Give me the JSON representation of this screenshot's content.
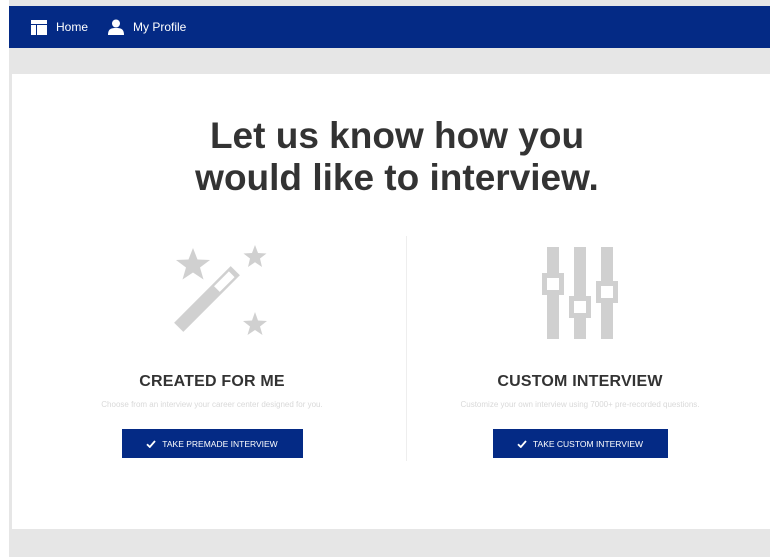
{
  "nav": {
    "home_label": "Home",
    "profile_label": "My Profile",
    "icons": {
      "home": "layout-icon",
      "profile": "user-icon"
    }
  },
  "main": {
    "headline_line1": "Let us know how you",
    "headline_line2": "would like to interview."
  },
  "options": [
    {
      "title": "CREATED FOR ME",
      "description": "Choose from an interview your career center designed for you.",
      "button_label": "TAKE PREMADE INTERVIEW",
      "icon": "magic-wand-icon"
    },
    {
      "title": "CUSTOM INTERVIEW",
      "description": "Customize your own interview using 7000+ pre-recorded questions.",
      "button_label": "TAKE CUSTOM INTERVIEW",
      "icon": "sliders-icon"
    }
  ],
  "colors": {
    "brand": "#042a85",
    "icon_gray": "#d0d0d0",
    "text_dark": "#333333",
    "text_muted": "#d9d9d9"
  }
}
